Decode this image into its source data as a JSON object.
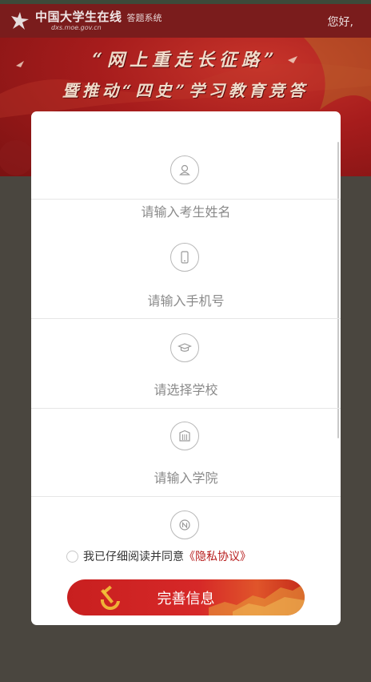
{
  "header": {
    "logo_title": "中国大学生在线",
    "logo_sub": "答题系统",
    "logo_domain": "dxs.moe.gov.cn",
    "greeting": "您好,"
  },
  "banner": {
    "line1": "“网上重走长征路”",
    "line2": "暨推动“四史”学习教育竞答"
  },
  "form": {
    "fields": [
      {
        "label": "请输入考生姓名",
        "icon": "person-icon"
      },
      {
        "label": "请输入手机号",
        "icon": "phone-icon"
      },
      {
        "label": "请选择学校",
        "icon": "graduation-cap-icon"
      },
      {
        "label": "请输入学院",
        "icon": "building-icon"
      },
      {
        "label": "",
        "icon": "college-badge-icon"
      }
    ],
    "agree_text": "我已仔细阅读并同意",
    "agree_link": "《隐私协议》",
    "submit_label": "完善信息"
  },
  "colors": {
    "header_bg": "#7a1c1c",
    "banner_red": "#a61c1c",
    "button_red": "#d62828",
    "link_red": "#b71c1c",
    "backdrop": "#4a463f"
  }
}
